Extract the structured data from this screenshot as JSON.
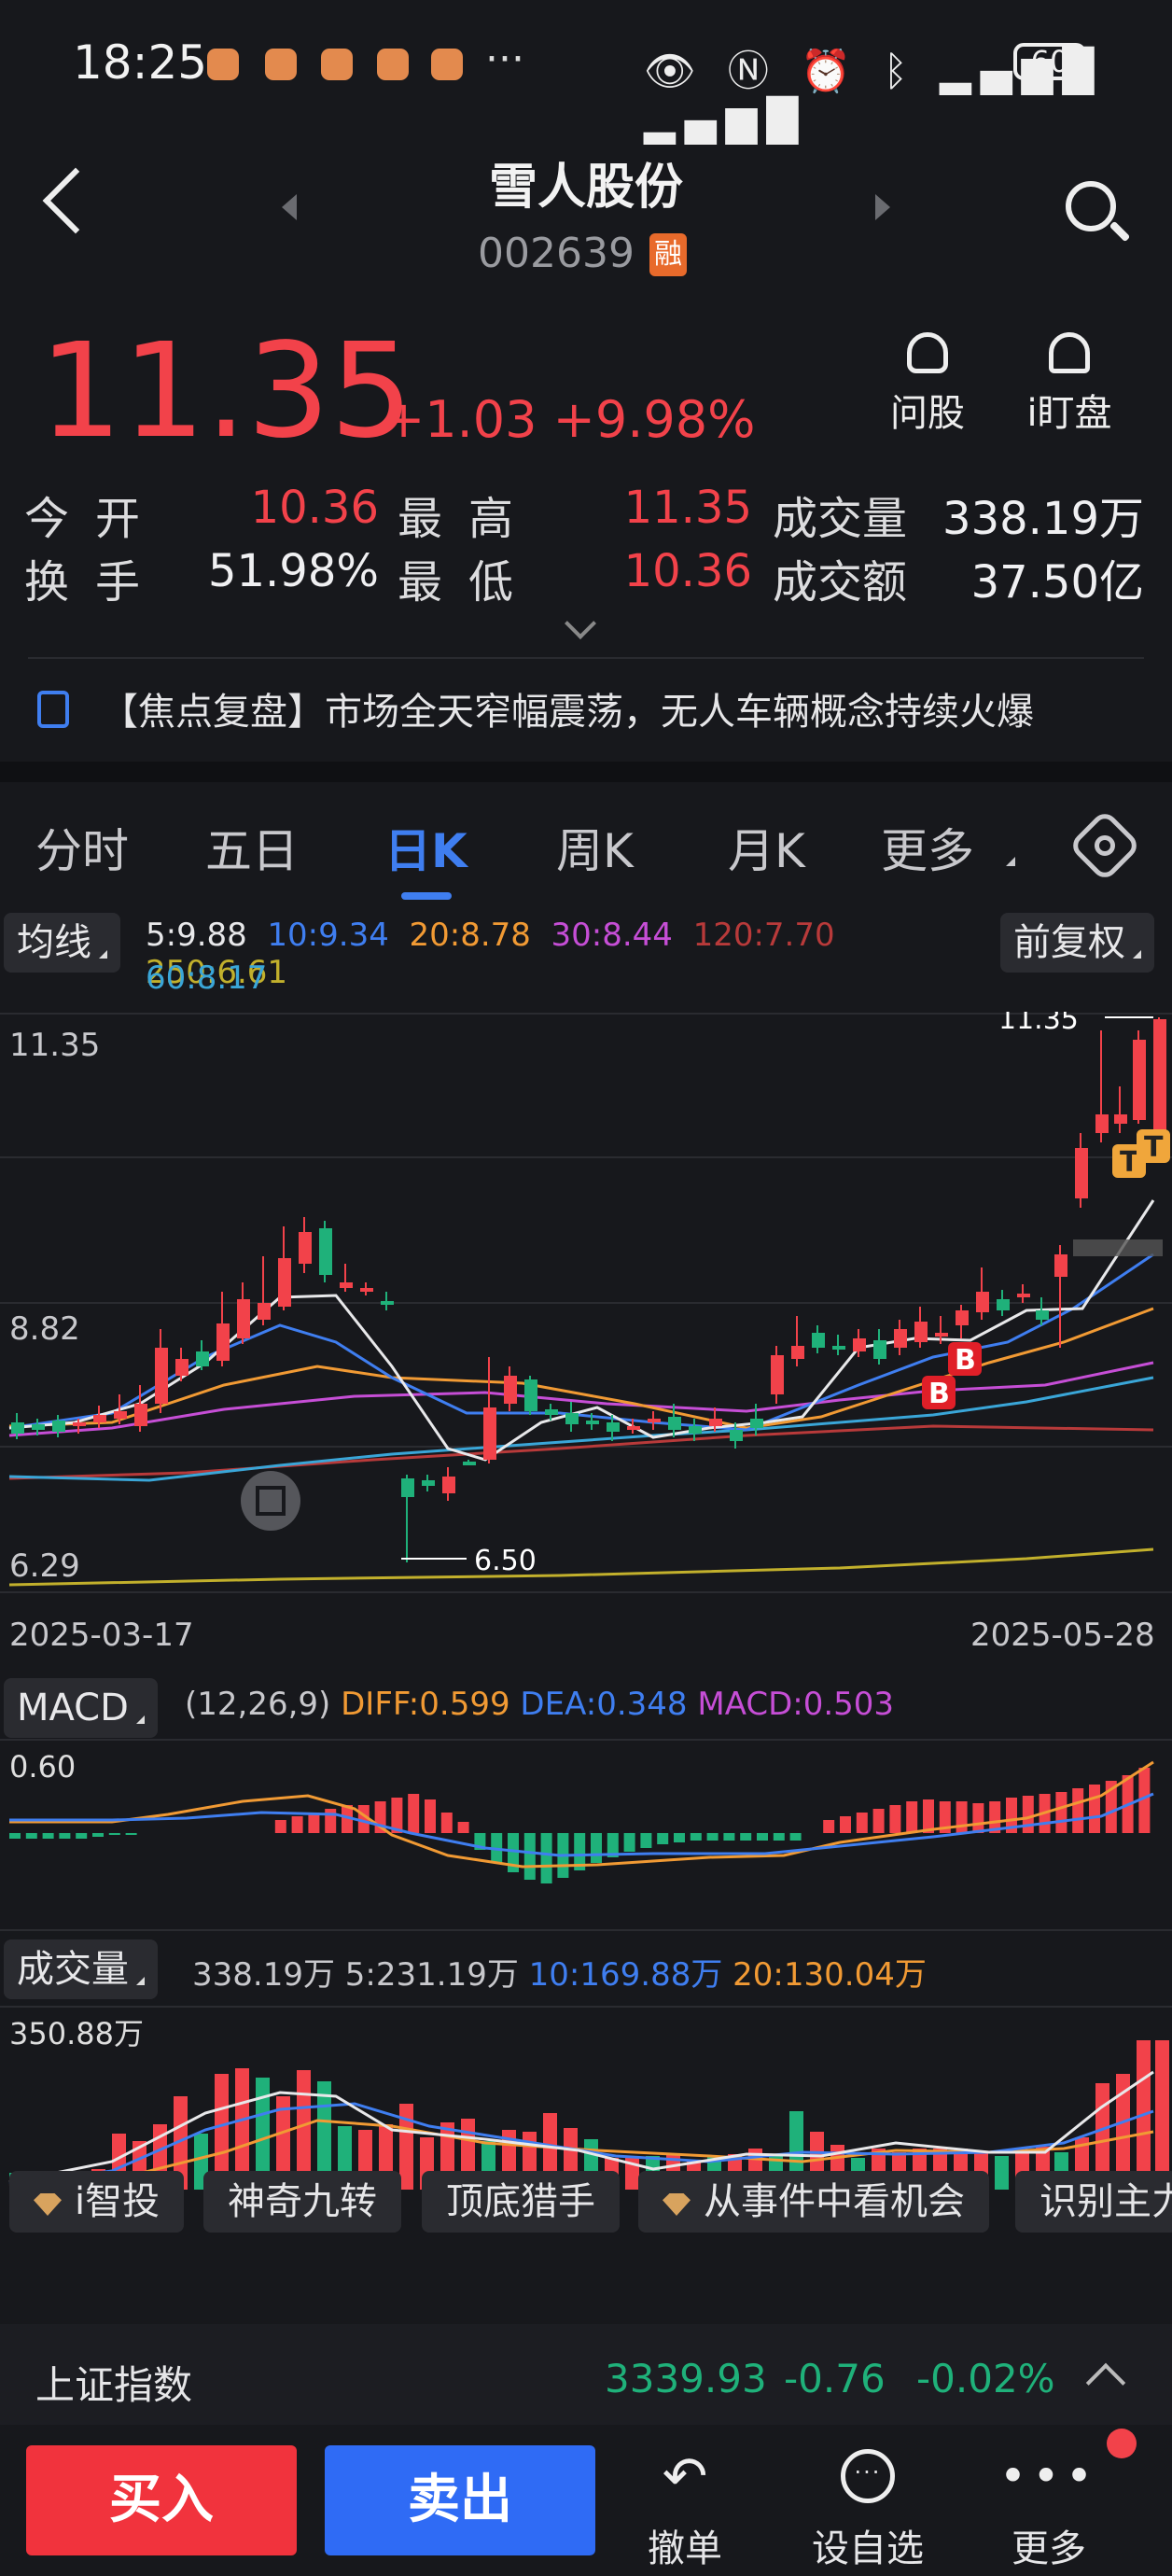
{
  "status_bar": {
    "time": "18:25",
    "dots": "···",
    "battery": "60"
  },
  "header": {
    "title": "雪人股份",
    "code": "002639",
    "rong_badge": "融"
  },
  "quote": {
    "price": "11.35",
    "change": "+1.03",
    "change_pct": "+9.98%",
    "stats": [
      {
        "label": "今开",
        "value": "10.36",
        "color": "red"
      },
      {
        "label": "最高",
        "value": "11.35",
        "color": "red"
      },
      {
        "label": "成交量",
        "value": "338.19万",
        "color": "white"
      },
      {
        "label": "换手",
        "value": "51.98%",
        "color": "white"
      },
      {
        "label": "最低",
        "value": "10.36",
        "color": "red"
      },
      {
        "label": "成交额",
        "value": "37.50亿",
        "color": "white"
      }
    ]
  },
  "actions": {
    "ask": "问股",
    "watch": "i盯盘"
  },
  "news": {
    "text": "【焦点复盘】市场全天窄幅震荡，无人车辆概念持续火爆"
  },
  "tabs": [
    "分时",
    "五日",
    "日K",
    "周K",
    "月K",
    "更多"
  ],
  "active_tab": "日K",
  "ma": {
    "selector": "均线",
    "adjust": "前复权",
    "legend": [
      {
        "label": "5:9.88",
        "color": "#e8e8ea"
      },
      {
        "label": "10:9.34",
        "color": "#3f7ef0"
      },
      {
        "label": "20:8.78",
        "color": "#f19a34"
      },
      {
        "label": "30:8.44",
        "color": "#c64ed6"
      },
      {
        "label": "120:7.70",
        "color": "#b83a3a"
      },
      {
        "label": "250:6.61",
        "color": "#c2b02c"
      },
      {
        "label": "60:8.17",
        "color": "#3aa6d8"
      }
    ]
  },
  "kline": {
    "y_top": "11.35",
    "y_mid": "8.82",
    "y_bot": "6.29",
    "high_marker": "11.35",
    "low_marker": "6.50",
    "date_start": "2025-03-17",
    "date_end": "2025-05-28",
    "signals": [
      "B",
      "B",
      "T",
      "T"
    ]
  },
  "macd": {
    "selector": "MACD",
    "params": "(12,26,9)",
    "diff": "DIFF:0.599",
    "dea": "DEA:0.348",
    "macd": "MACD:0.503",
    "y_top": "0.60"
  },
  "volume": {
    "selector": "成交量",
    "total": "338.19万",
    "ma5": "5:231.19万",
    "ma10": "10:169.88万",
    "ma20": "20:130.04万",
    "y_top": "350.88万"
  },
  "chips": [
    "i智投",
    "神奇九转",
    "顶底猎手",
    "从事件中看机会",
    "识别主力"
  ],
  "index": {
    "name": "上证指数",
    "value": "3339.93",
    "change": "-0.76",
    "pct": "-0.02%"
  },
  "bottom": {
    "buy": "买入",
    "sell": "卖出",
    "cancel": "撤单",
    "favorite": "设自选",
    "more": "更多"
  }
}
